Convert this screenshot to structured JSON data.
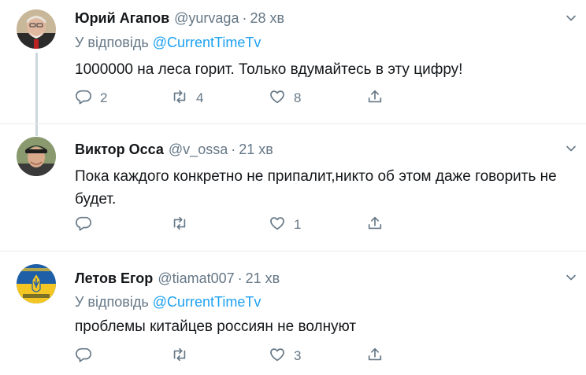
{
  "tweets": [
    {
      "name": "Юрий Агапов",
      "handle": "@yurvaga",
      "dot": "·",
      "time": "28 хв",
      "reply_prefix": "У відповідь",
      "reply_mention": "@CurrentTimeTv",
      "text": "1000000 на леса горит. Только вдумайтесь в эту цифру!",
      "replies": "2",
      "retweets": "4",
      "likes": "8"
    },
    {
      "name": "Виктор Осса",
      "handle": "@v_ossa",
      "dot": "·",
      "time": "21 хв",
      "text": "Пока каждого конкретно не припалит,никто об этом даже говорить не будет.",
      "likes": "1"
    },
    {
      "name": "Летов Егор",
      "handle": "@tiamat007",
      "dot": "·",
      "time": "21 хв",
      "reply_prefix": "У відповідь",
      "reply_mention": "@CurrentTimeTv",
      "text": "проблемы китайцев россиян не волнуют",
      "likes": "3"
    }
  ],
  "icons": {
    "reply": "reply-icon",
    "retweet": "retweet-icon",
    "like": "heart-icon",
    "share": "share-icon",
    "caret": "chevron-down-icon"
  },
  "colors": {
    "text": "#14171a",
    "secondary": "#657786",
    "link": "#1da1f2",
    "divider": "#e6ecf0",
    "thread_line": "#ccd6dd"
  }
}
